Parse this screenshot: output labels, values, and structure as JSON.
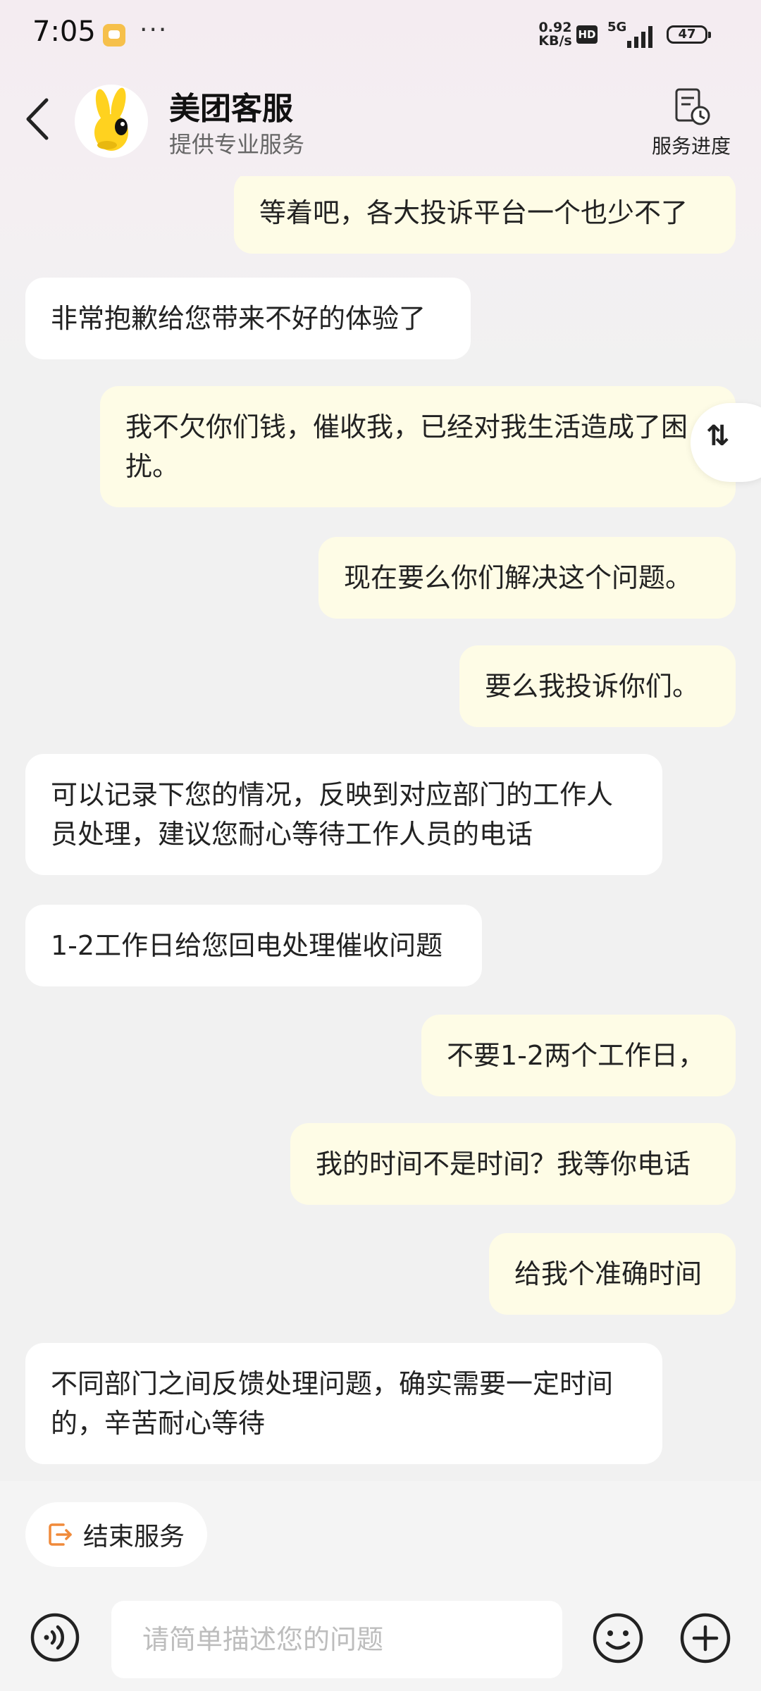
{
  "status_bar": {
    "time": "7:05",
    "more": "···",
    "net_speed_value": "0.92",
    "net_speed_unit": "KB/s",
    "hd": "HD",
    "network": "5G",
    "battery": "47"
  },
  "header": {
    "title": "美团客服",
    "subtitle": "提供专业服务",
    "progress_label": "服务进度"
  },
  "messages": [
    {
      "from": "me",
      "text": "等着吧，各大投诉平台一个也少不了"
    },
    {
      "from": "agent",
      "text": "非常抱歉给您带来不好的体验了"
    },
    {
      "from": "me",
      "text": "我不欠你们钱，催收我，已经对我生活造成了困扰。"
    },
    {
      "from": "me",
      "text": "现在要么你们解决这个问题。"
    },
    {
      "from": "me",
      "text": "要么我投诉你们。"
    },
    {
      "from": "agent",
      "text": "可以记录下您的情况，反映到对应部门的工作人员处理，建议您耐心等待工作人员的电话"
    },
    {
      "from": "agent",
      "text": "1-2工作日给您回电处理催收问题"
    },
    {
      "from": "me",
      "text": "不要1-2两个工作日，"
    },
    {
      "from": "me",
      "text": "我的时间不是时间？我等你电话"
    },
    {
      "from": "me",
      "text": "给我个准确时间"
    },
    {
      "from": "agent",
      "text": "不同部门之间反馈处理问题，确实需要一定时间的，辛苦耐心等待"
    }
  ],
  "scroll_fab": "⇅",
  "bottom": {
    "end_service_label": "结束服务",
    "input_placeholder": "请简单描述您的问题"
  },
  "colors": {
    "my_bubble": "#fefce6",
    "agent_bubble": "#ffffff",
    "end_icon": "#f08a3a"
  }
}
